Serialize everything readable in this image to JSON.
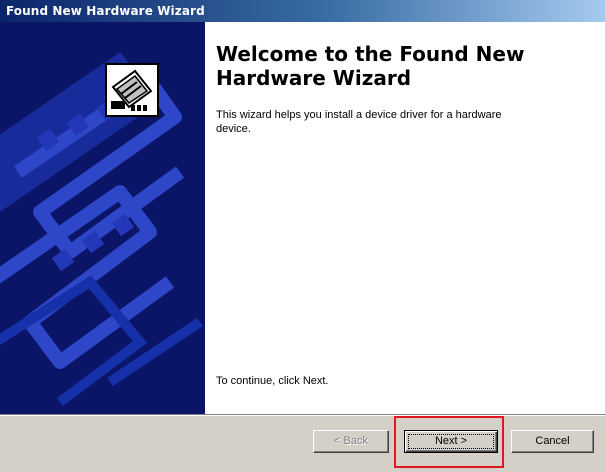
{
  "window": {
    "title": "Found New Hardware Wizard"
  },
  "wizard": {
    "heading": "Welcome to the Found New Hardware Wizard",
    "description": "This wizard helps you install a device driver for a hardware device.",
    "continue_text": "To continue, click Next."
  },
  "buttons": {
    "back_label": "< Back",
    "next_label": "Next >",
    "cancel_label": "Cancel"
  },
  "icons": {
    "hardware_icon": "hardware-card-icon"
  },
  "colors": {
    "titlebar_start": "#0a246a",
    "titlebar_end": "#a6caf0",
    "side_panel": "#0a1568",
    "highlight_box": "#e0161b"
  }
}
